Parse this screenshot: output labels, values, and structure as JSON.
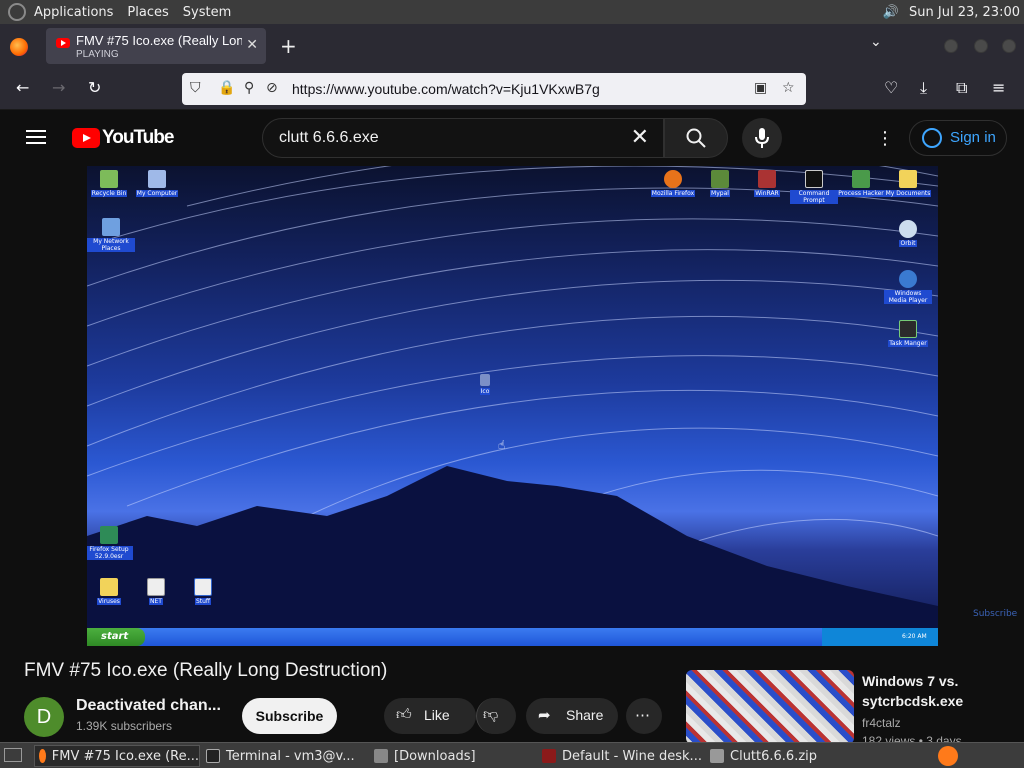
{
  "panel": {
    "menus": [
      "Applications",
      "Places",
      "System"
    ],
    "clock": "Sun Jul 23, 23:00"
  },
  "browser": {
    "tab": {
      "title": "FMV #75 Ico.exe (Really Lon",
      "status": "PLAYING"
    },
    "url": "https://www.youtube.com/watch?v=Kju1VKxwB7g"
  },
  "youtube": {
    "logo_text": "YouTube",
    "search_value": "clutt 6.6.6.exe",
    "sign_in": "Sign in"
  },
  "video": {
    "desktop_icons": [
      "Recycle Bin",
      "My Computer",
      "My Network Places",
      "Mozilla Firefox",
      "Mypal",
      "WinRAR",
      "Command Prompt",
      "Process Hacker",
      "My Documents",
      "Orbit",
      "Windows Media Player",
      "Task Manger",
      "Ico",
      "Firefox Setup 52.9.0esr",
      "Viruses",
      "NET",
      "Stuff"
    ],
    "start_label": "start",
    "tray_time": "6:20 AM",
    "watermark": "Subscribe"
  },
  "meta": {
    "title": "FMV #75 Ico.exe (Really Long Destruction)",
    "avatar_letter": "D",
    "channel": "Deactivated chan...",
    "subscribers": "1.39K subscribers",
    "subscribe": "Subscribe",
    "like": "Like",
    "share": "Share"
  },
  "related": {
    "title": "Windows 7 vs. sytcrbcdsk.exe",
    "channel": "fr4ctalz",
    "meta": "182 views • 3 days"
  },
  "taskbar": {
    "items": [
      "FMV #75 Ico.exe (Re...",
      "Terminal - vm3@v...",
      "[Downloads]",
      "Default - Wine desk...",
      "Clutt6.6.6.zip"
    ]
  },
  "colors": {
    "accent": "#3ea6ff",
    "yt_red": "#ff0000"
  }
}
